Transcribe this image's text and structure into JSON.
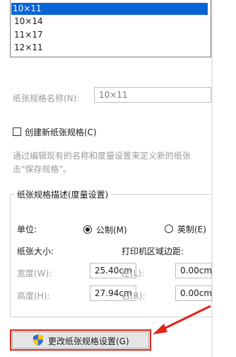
{
  "sizes_list": {
    "items": [
      "10×11",
      "10×14",
      "11×17",
      "12×11"
    ],
    "selected_index": 0
  },
  "form_name": {
    "label": "纸张规格名称(N):",
    "value": "10×11"
  },
  "create_new": {
    "label": "创建新纸张规格(C)",
    "checked": false
  },
  "help": {
    "line1": "通过编辑现有的名称和度量设置来定义新的纸张",
    "line2": "击\"保存规格\"。"
  },
  "desc_group": {
    "title": "纸张规格描述(度量设置)",
    "unit_label": "单位:",
    "metric_label": "公制(M)",
    "english_label": "英制(E)",
    "unit_selected": "metric",
    "paper_size_label": "纸张大小:",
    "margins_label": "打印机区域边距:",
    "width_label": "宽度(W):",
    "width_value": "25.40cm",
    "height_label": "高度(H):",
    "height_value": "27.94cm",
    "left_label": "左(L):",
    "left_value": "0.00cm",
    "right_label": "右(R):",
    "right_value": "0.00cm"
  },
  "change_button": {
    "label": "更改纸张规格设置(G)"
  },
  "colors": {
    "selection": "#0a64d6",
    "annotation_red": "#e2231a",
    "disabled_text": "#9a9a9a"
  }
}
